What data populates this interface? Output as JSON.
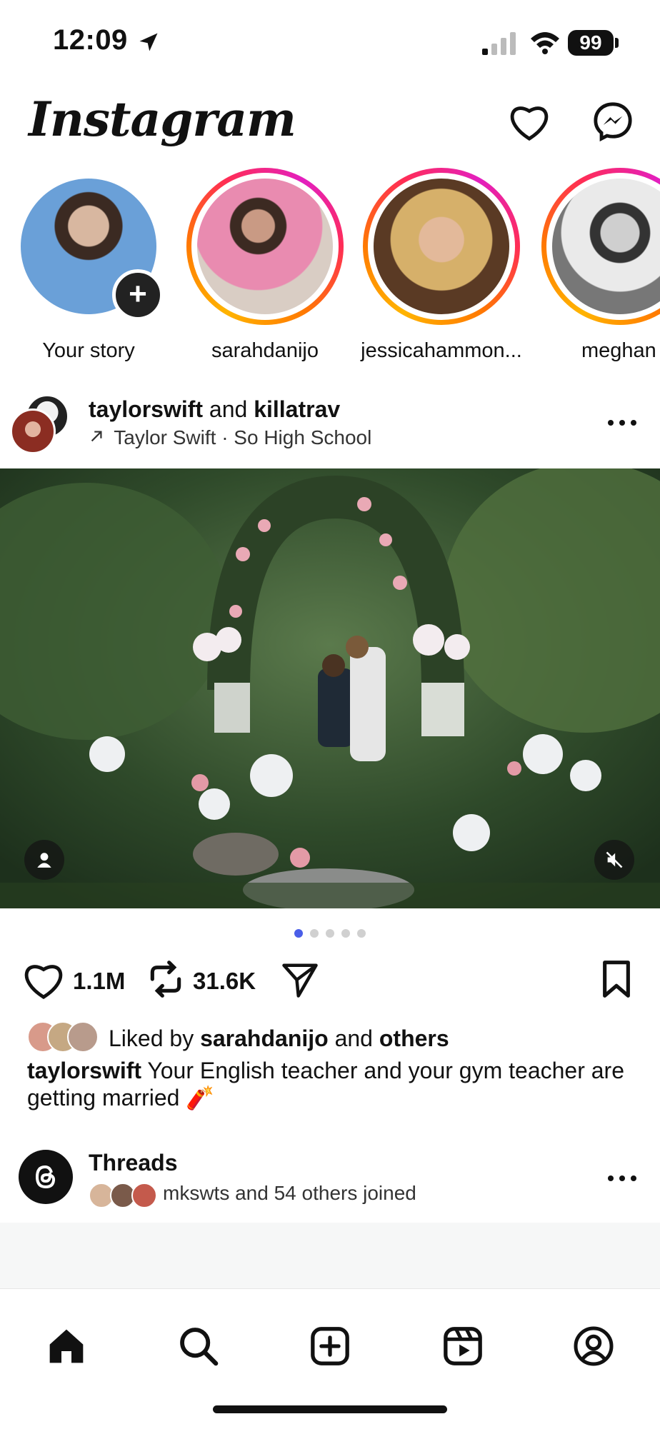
{
  "status_bar": {
    "time": "12:09",
    "battery": "99"
  },
  "header": {
    "logo_text": "Instagram"
  },
  "stories": [
    {
      "label": "Your story",
      "has_ring": false
    },
    {
      "label": "sarahdanijo",
      "has_ring": true
    },
    {
      "label": "jessicahammon...",
      "has_ring": true
    },
    {
      "label": "meghan",
      "has_ring": true
    }
  ],
  "post": {
    "author1": "taylorswift",
    "joiner": "and",
    "author2": "killatrav",
    "audio": "Taylor Swift · So High School",
    "media_dots": {
      "count": 5,
      "active": 1
    },
    "likes": "1.1M",
    "reposts": "31.6K",
    "liked_by_prefix": "Liked by",
    "liked_by_user": "sarahdanijo",
    "liked_by_mid": "and",
    "liked_by_suffix": "others",
    "caption_user": "taylorswift",
    "caption_text": "Your English teacher and your gym teacher are getting married 🧨"
  },
  "threads": {
    "title": "Threads",
    "subtitle": "mkswts and 54 others joined"
  },
  "colors": {
    "accent_blue": "#4a5ee8",
    "ring_gradient_start": "#ffb400",
    "ring_gradient_end": "#e31fbf"
  },
  "icons": {
    "header": [
      "heart-icon",
      "messenger-icon"
    ],
    "actions": [
      "heart-icon",
      "repost-icon",
      "send-icon",
      "bookmark-icon"
    ],
    "tabs": [
      "home-icon",
      "search-icon",
      "new-post-icon",
      "reels-icon",
      "profile-icon"
    ]
  }
}
